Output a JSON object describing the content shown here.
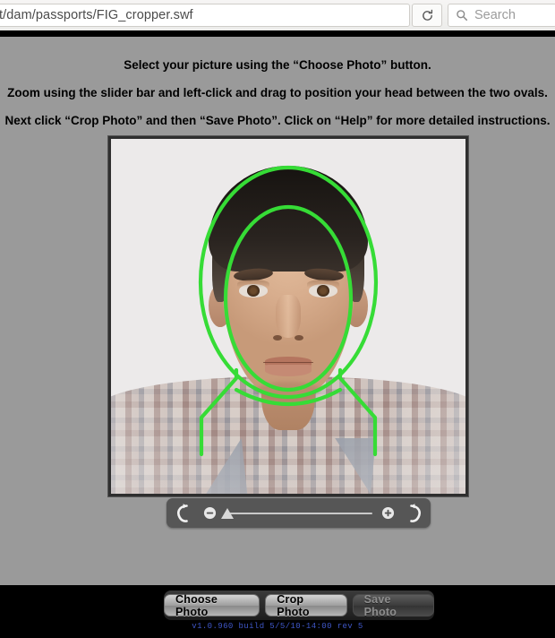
{
  "browser": {
    "url": "t/dam/passports/FIG_cropper.swf",
    "reload_icon": "reload-icon",
    "search_icon": "search-icon",
    "search_placeholder": "Search"
  },
  "instructions": [
    "Select your picture using the “Choose Photo” button.",
    "Zoom using the slider bar and left-click and drag to position your head between the two ovals.",
    "Next click “Crop Photo” and then “Save Photo”.  Click on “Help” for more detailed instructions."
  ],
  "photo": {
    "alt": "passport photo of a man facing camera in plaid shirt",
    "guide_color": "#36dc36",
    "background_color": "#eceaea",
    "frame_color": "#2f2f2f"
  },
  "toolbar": {
    "rotate_left_icon": "rotate-counterclockwise-icon",
    "rotate_right_icon": "rotate-clockwise-icon",
    "zoom_out_icon": "minus-circle-icon",
    "zoom_in_icon": "plus-circle-icon",
    "slider_value": 0,
    "slider_min": 0,
    "slider_max": 100
  },
  "buttons": {
    "choose_photo": "Choose Photo",
    "crop_photo": "Crop Photo",
    "save_photo": "Save Photo",
    "save_photo_disabled": true
  },
  "version": "v1.0.960 build 5/5/10-14:00 rev 5"
}
